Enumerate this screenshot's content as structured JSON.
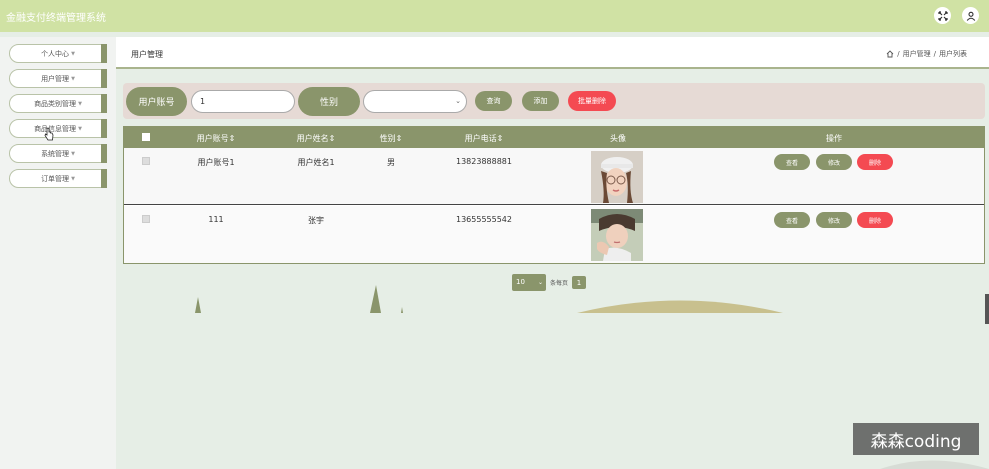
{
  "app": {
    "title": "金融支付终端管理系统"
  },
  "sidebar": {
    "items": [
      {
        "label": "个人中心"
      },
      {
        "label": "用户管理"
      },
      {
        "label": "商品类别管理"
      },
      {
        "label": "商品信息管理"
      },
      {
        "label": "系统管理"
      },
      {
        "label": "订单管理"
      }
    ]
  },
  "breadcrumb": {
    "title": "用户管理",
    "path": [
      "用户管理",
      "用户列表"
    ],
    "separator": "/"
  },
  "filters": {
    "account_label": "用户账号",
    "account_value": "1",
    "gender_label": "性别",
    "gender_value": "",
    "search_label": "查询",
    "add_label": "添加",
    "batch_delete_label": "批量删除"
  },
  "table": {
    "columns": [
      "用户账号",
      "用户姓名",
      "性别",
      "用户电话",
      "头像",
      "操作"
    ],
    "rows": [
      {
        "account": "用户账号1",
        "name": "用户姓名1",
        "gender": "男",
        "phone": "13823888881",
        "actions": [
          "查看",
          "修改",
          "删除"
        ]
      },
      {
        "account": "111",
        "name": "张宇",
        "gender": "",
        "phone": "13655555542",
        "actions": [
          "查看",
          "修改",
          "删除"
        ]
      }
    ]
  },
  "pagination": {
    "page_size": "10",
    "per_page_label": "条每页",
    "current_page": "1"
  },
  "watermark": "森森coding",
  "colors": {
    "accent": "#8a956b",
    "topbar": "#d0e2a4",
    "danger": "#f44a52",
    "filter_bg": "#e6dad5"
  }
}
